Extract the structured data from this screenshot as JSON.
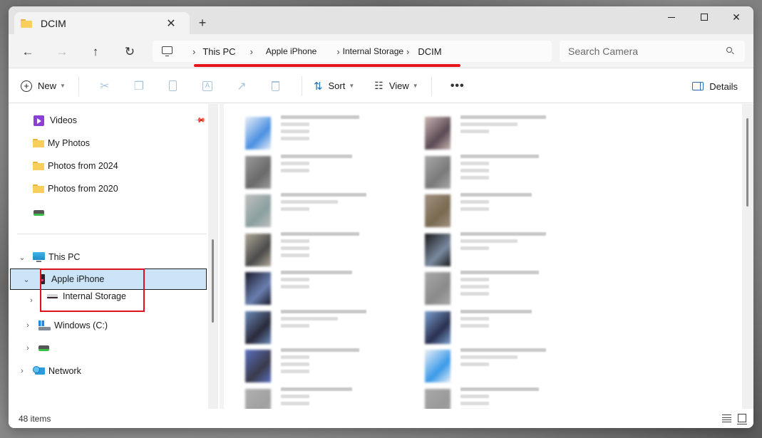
{
  "window": {
    "tab_title": "DCIM",
    "tab_close_glyph": "✕",
    "new_tab_glyph": "+",
    "controls": {
      "minimize": "minimize",
      "maximize": "maximize",
      "close_glyph": "✕"
    }
  },
  "navigation": {
    "back_glyph": "←",
    "forward_glyph": "→",
    "up_glyph": "↑",
    "refresh_glyph": "↻"
  },
  "breadcrumb": {
    "root_icon": "computer-icon",
    "separator": "›",
    "items": [
      "This PC",
      "Apple iPhone",
      "Internal Storage",
      "DCIM"
    ],
    "highlight_color": "#e8141c"
  },
  "search": {
    "placeholder": "Search Camera",
    "value": ""
  },
  "toolbar": {
    "new_label": "New",
    "sort_label": "Sort",
    "view_label": "View",
    "more_glyph": "•••",
    "details_label": "Details",
    "disabled_actions": [
      "cut",
      "copy",
      "paste",
      "rename",
      "share",
      "delete"
    ],
    "icons": {
      "cut": "✂",
      "copy": "❐",
      "paste": "📋",
      "rename": "A",
      "share": "↗",
      "delete": "🗑"
    }
  },
  "nav_pane": {
    "quick_access": [
      {
        "label": "Videos",
        "icon": "videos-icon",
        "pinned": true
      },
      {
        "label": "My Photos",
        "icon": "folder-icon"
      },
      {
        "label": "Photos from 2024",
        "icon": "folder-icon"
      },
      {
        "label": "Photos from 2020",
        "icon": "folder-icon"
      },
      {
        "label": "",
        "icon": "drive-icon"
      }
    ],
    "tree": [
      {
        "label": "This PC",
        "icon": "this-pc-icon",
        "expanded": true,
        "chevron": "⌄"
      },
      {
        "label": "Apple iPhone",
        "icon": "phone-icon",
        "expanded": true,
        "selected": true,
        "chevron": "⌄"
      },
      {
        "label": "Internal Storage",
        "icon": "storage-icon",
        "chevron": "›"
      },
      {
        "label": "Windows (C:)",
        "icon": "windows-drive-icon",
        "chevron": "›"
      },
      {
        "label": "",
        "icon": "drive-icon",
        "chevron": "›"
      },
      {
        "label": "Network",
        "icon": "network-icon",
        "chevron": "›"
      }
    ],
    "highlight_color": "#e0101a",
    "selected_color": "#cce4f7"
  },
  "content": {
    "view_mode": "tiles",
    "files_obscured": true,
    "tile_count_visible": 16
  },
  "status": {
    "item_count": "48 items"
  }
}
